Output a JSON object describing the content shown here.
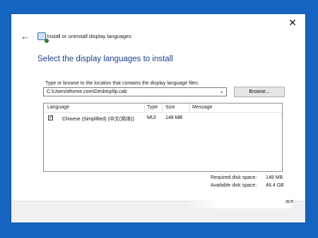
{
  "window": {
    "title": "Install or uninstall display languages",
    "close_symbol": "✕",
    "back_symbol": "←"
  },
  "page": {
    "heading": "Select the display languages to install",
    "path_label": "Type or browse to the location that contains the display language files:",
    "path_value": "C:\\Users\\ithome.com\\Desktop\\lp.cab",
    "dropdown_symbol": "⌄",
    "browse_label": "Browse..."
  },
  "list": {
    "columns": [
      "Language",
      "Type",
      "Size",
      "Message"
    ],
    "rows": [
      {
        "checked": true,
        "language": "Chinese (Simplified) (中文(简体))",
        "type": "MUI",
        "size": "148 MB",
        "message": ""
      }
    ]
  },
  "disk": {
    "required_label": "Required disk space:",
    "required_value": "148 MB",
    "available_label": "Available disk space:",
    "available_value": "48.4 GB"
  },
  "footer": {
    "partial_text": "ace"
  },
  "colors": {
    "desktop": "#1565c0",
    "heading": "#1e3d8f"
  },
  "icons": [
    "back-arrow-icon",
    "language-install-icon",
    "close-icon",
    "chevron-down-icon",
    "checkbox-checked-icon"
  ]
}
